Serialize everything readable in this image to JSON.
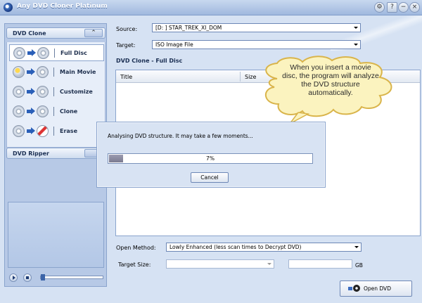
{
  "window": {
    "title": "Any DVD Cloner Platinum",
    "buttons": {
      "settings": "⚙",
      "help": "?",
      "minimize": "−",
      "close": "×"
    }
  },
  "sidebar": {
    "dvd_clone": {
      "title": "DVD Clone",
      "collapse_glyph": "⌃",
      "items": [
        {
          "label": "Full Disc",
          "icon": "full-disc-icon",
          "selected": true
        },
        {
          "label": "Main Movie",
          "icon": "main-movie-icon",
          "selected": false
        },
        {
          "label": "Customize",
          "icon": "customize-icon",
          "selected": false
        },
        {
          "label": "Clone",
          "icon": "clone-icon",
          "selected": false
        },
        {
          "label": "Erase",
          "icon": "erase-icon",
          "selected": false
        }
      ]
    },
    "dvd_ripper": {
      "title": "DVD Ripper"
    }
  },
  "main": {
    "source_label": "Source:",
    "source_value": "[D: ] STAR_TREK_XI_DOM",
    "target_label": "Target:",
    "target_value": "ISO Image File",
    "section_title": "DVD Clone - Full Disc",
    "columns": [
      "Title",
      "Size"
    ],
    "open_method_label": "Open Method:",
    "open_method_value": "Lowly Enhanced  (less scan times to Decrypt DVD)",
    "target_size_label": "Target Size:",
    "target_size_value": "",
    "size_unit": "GB",
    "open_dvd_label": "Open DVD"
  },
  "callout": {
    "text": "When you insert a movie disc, the program will analyze the DVD structure automatically."
  },
  "dialog": {
    "message": "Analysing DVD structure. It may take a few moments...",
    "progress_percent": 7,
    "progress_text": "7%",
    "cancel_label": "Cancel"
  },
  "colors": {
    "accent": "#2a5fb8",
    "panel": "#d8e3f3",
    "bubble": "#fbf3bf"
  }
}
